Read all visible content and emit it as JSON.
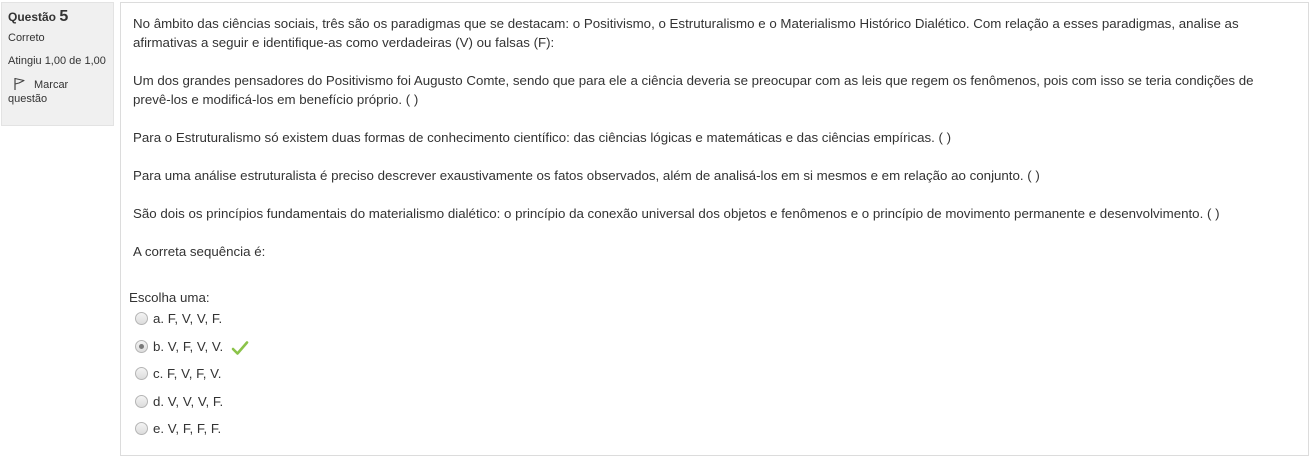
{
  "question_info": {
    "label": "Questão",
    "number": "5",
    "state": "Correto",
    "grade": "Atingiu 1,00 de 1,00",
    "flag_label": "Marcar questão"
  },
  "question_text": {
    "intro": "No âmbito das ciências sociais, três são os paradigmas que se destacam: o Positivismo, o Estruturalismo e o Materialismo Histórico Dialético. Com relação a esses paradigmas, analise as afirmativas a seguir e identifique-as como verdadeiras (V) ou falsas (F):",
    "statements": [
      "Um dos grandes pensadores do Positivismo foi Augusto Comte, sendo que para ele a ciência deveria se preocupar com as leis que regem os fenômenos, pois com isso se teria condições de prevê-los e modificá-los em benefício próprio. ( )",
      "Para o Estruturalismo só existem duas formas de conhecimento científico: das ciências lógicas e matemáticas e das ciências empíricas. ( )",
      "Para uma análise estruturalista é preciso descrever exaustivamente os fatos observados, além de analisá-los em si mesmos e em relação ao conjunto. ( )",
      "São dois os princípios fundamentais do materialismo dialético: o princípio da conexão universal dos objetos e fenômenos e o princípio de movimento permanente e desenvolvimento. ( )"
    ],
    "closing": "A correta sequência é:"
  },
  "answer": {
    "prompt": "Escolha uma:",
    "options": [
      {
        "label": "a. F, V, V, F.",
        "selected": false,
        "correct": false
      },
      {
        "label": "b. V, F, V, V.",
        "selected": true,
        "correct": true
      },
      {
        "label": "c. F, V, F, V.",
        "selected": false,
        "correct": false
      },
      {
        "label": "d. V, V, V, F.",
        "selected": false,
        "correct": false
      },
      {
        "label": "e. V, F, F, F.",
        "selected": false,
        "correct": false
      }
    ]
  },
  "colors": {
    "correct_check": "#8bc34a",
    "info_panel_bg": "#f0f0f0"
  }
}
